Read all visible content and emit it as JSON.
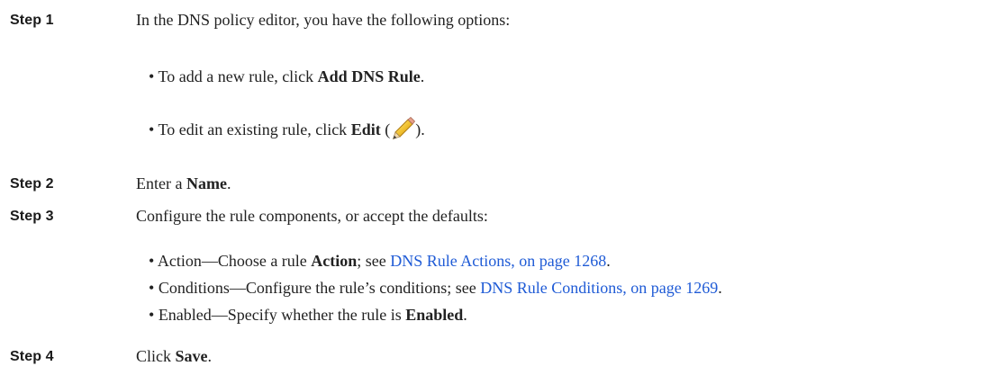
{
  "steps": [
    {
      "label": "Step 1",
      "text": "In the DNS policy editor, you have the following options:",
      "bullets": [
        {
          "pre": "To add a new rule, click ",
          "bold": "Add DNS Rule",
          "post": "."
        },
        {
          "pre": "To edit an existing rule, click ",
          "bold": "Edit",
          "open": " (",
          "icon": "pencil-icon",
          "close": ")."
        }
      ]
    },
    {
      "label": "Step 2",
      "pre": "Enter a ",
      "bold": "Name",
      "post": "."
    },
    {
      "label": "Step 3",
      "text": "Configure the rule components, or accept the defaults:",
      "bullets": [
        {
          "pre": "Action—Choose a rule ",
          "bold": "Action",
          "mid": "; see ",
          "link": "DNS Rule Actions, on page 1268",
          "post": "."
        },
        {
          "pre": "Conditions—Configure the rule’s conditions; see ",
          "link": "DNS Rule Conditions, on page 1269",
          "post": "."
        },
        {
          "pre": "Enabled—Specify whether the rule is ",
          "bold": "Enabled",
          "post": "."
        }
      ]
    },
    {
      "label": "Step 4",
      "pre": "Click ",
      "bold": "Save",
      "post": "."
    }
  ],
  "bullet_char": "•"
}
